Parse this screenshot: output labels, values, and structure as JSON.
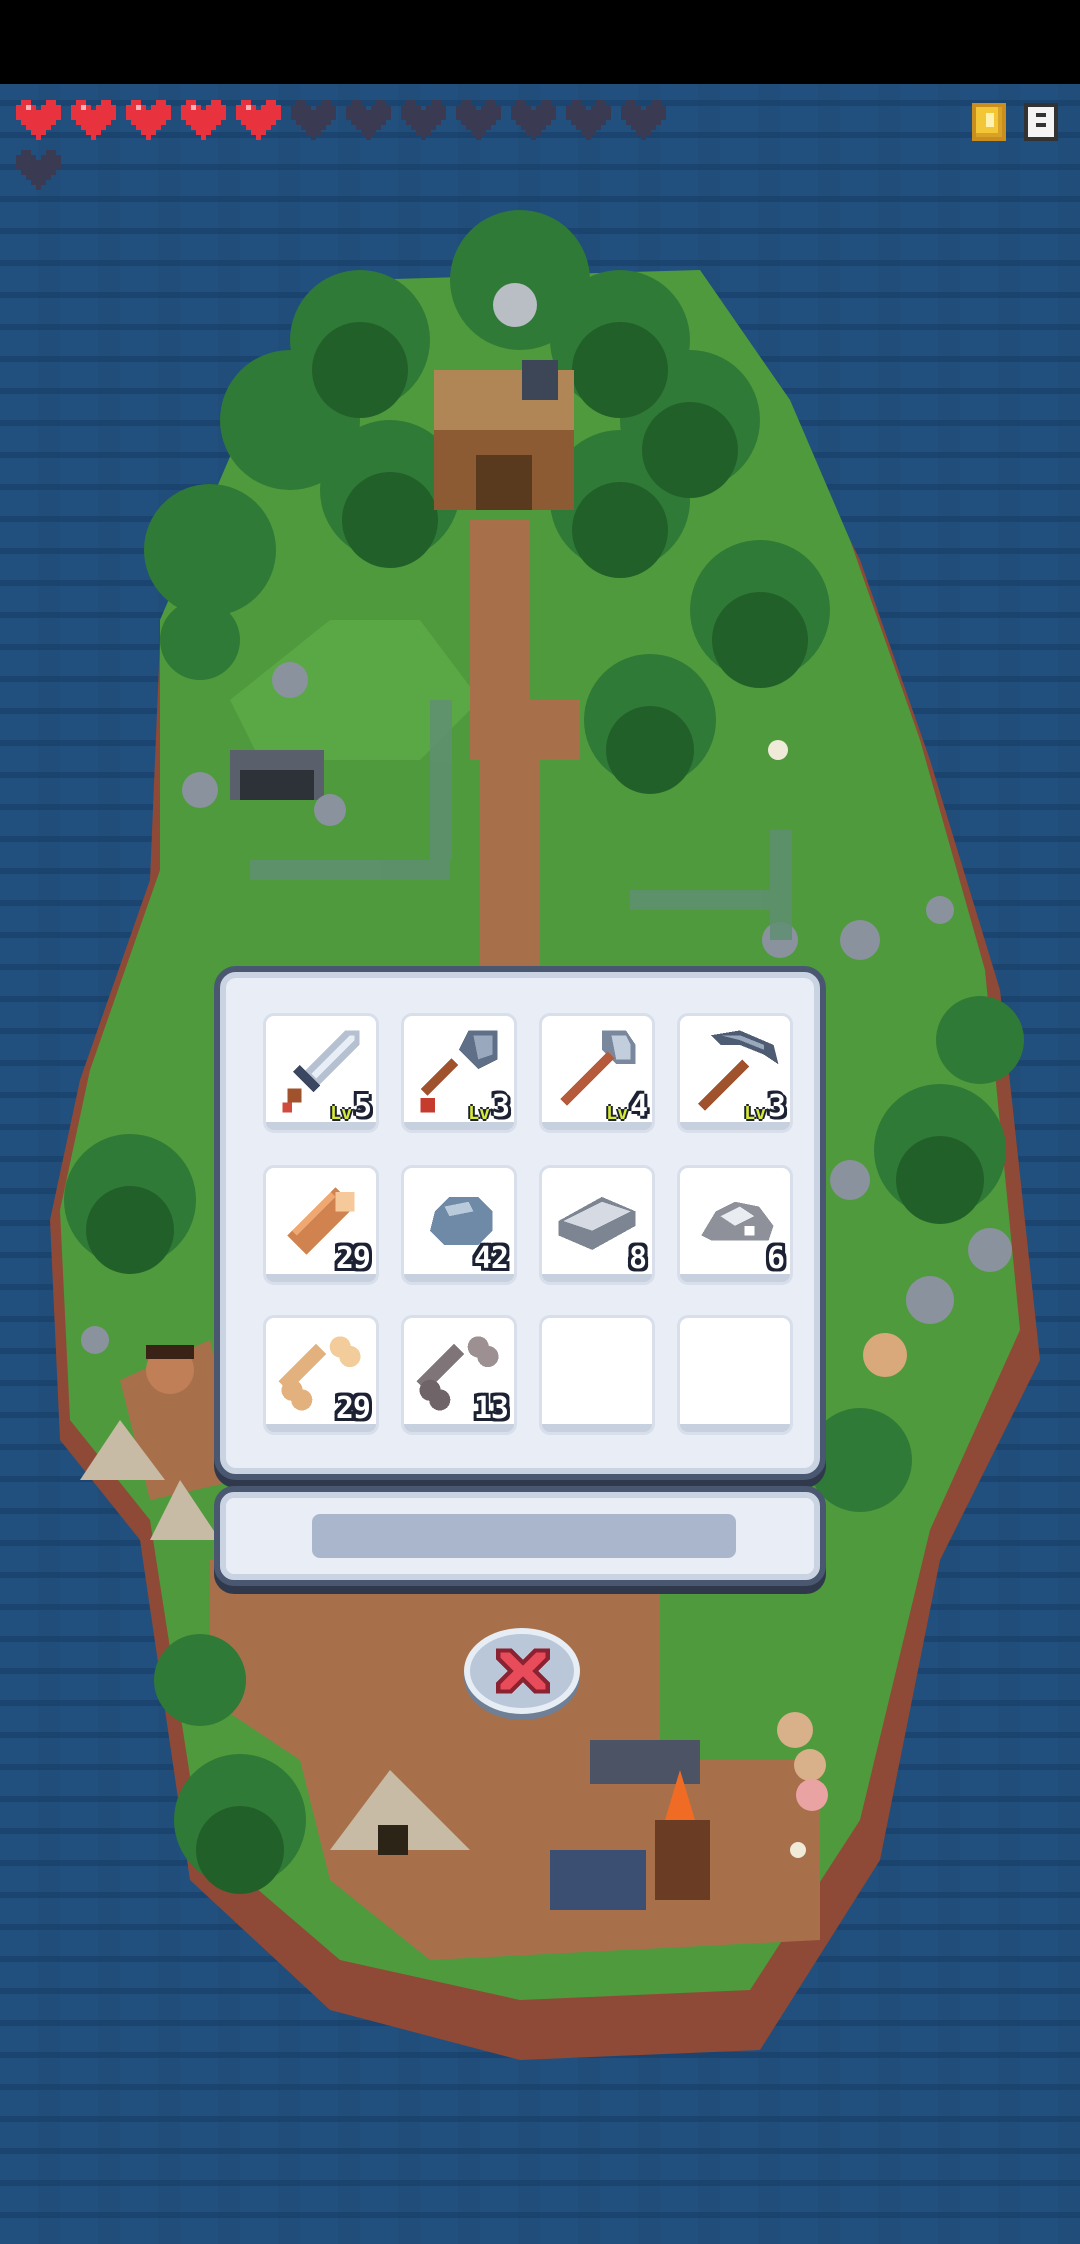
{
  "hud": {
    "hearts_total": 13,
    "hearts_full": 5,
    "top_right_icons": [
      "coin-icon",
      "scroll-icon"
    ]
  },
  "inventory": {
    "slots": [
      {
        "icon": "sword-icon",
        "level_prefix": "Lv",
        "level": "5"
      },
      {
        "icon": "shovel-icon",
        "level_prefix": "Lv",
        "level": "3"
      },
      {
        "icon": "axe-icon",
        "level_prefix": "Lv",
        "level": "4"
      },
      {
        "icon": "pickaxe-icon",
        "level_prefix": "Lv",
        "level": "3"
      },
      {
        "icon": "wood-log-icon",
        "quantity": "29"
      },
      {
        "icon": "stone-icon",
        "quantity": "42"
      },
      {
        "icon": "iron-bar-icon",
        "quantity": "8"
      },
      {
        "icon": "ore-icon",
        "quantity": "6"
      },
      {
        "icon": "bone-icon",
        "quantity": "29"
      },
      {
        "icon": "dark-bone-icon",
        "quantity": "13"
      },
      {
        "icon": "empty-slot"
      },
      {
        "icon": "empty-slot"
      }
    ]
  },
  "close_button": {
    "icon": "close-icon"
  },
  "colors": {
    "ocean": "#21507e",
    "grass": "#4f9a3c",
    "dirt": "#a7704b",
    "panel_bg": "#e9eef6",
    "panel_border": "#4a5770",
    "heart_full": "#e8323d",
    "heart_empty": "#3a3a52"
  }
}
